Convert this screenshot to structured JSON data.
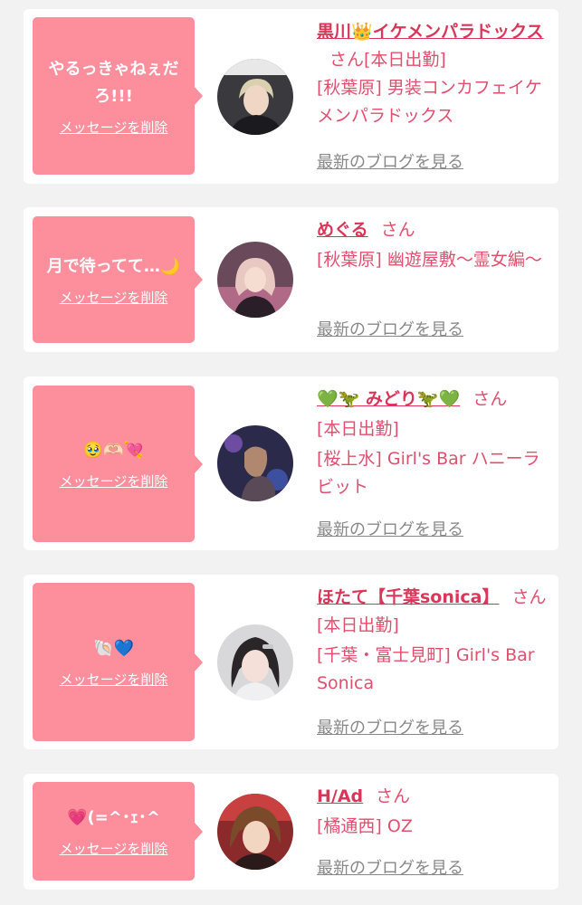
{
  "cards": [
    {
      "message": "やるっきゃねぇだろ!!!",
      "delete_label": "メッセージを削除",
      "name": "黒川👑イケメンパラドックス",
      "san": "さん",
      "status": "[本日出勤]",
      "shop": "[秋葉原] 男装コンカフェイケメンパラドックス",
      "blog_label": "最新のブログを見る",
      "avatar_icon": "profile-photo-icon"
    },
    {
      "message": "月で待ってて…🌙",
      "delete_label": "メッセージを削除",
      "name": "めぐる",
      "san": "さん",
      "status": "",
      "shop": "[秋葉原] 幽遊屋敷～霊女編～",
      "blog_label": "最新のブログを見る",
      "avatar_icon": "profile-photo-icon"
    },
    {
      "message": "🥹🫶🏻💘",
      "delete_label": "メッセージを削除",
      "name": "💚🦖 みどり🦖💚",
      "san": "さん",
      "status": "[本日出勤]",
      "shop": "[桜上水] Girl's Bar ハニーラビット",
      "blog_label": "最新のブログを見る",
      "avatar_icon": "profile-photo-icon"
    },
    {
      "message": "🐚💙",
      "delete_label": "メッセージを削除",
      "name": "ほたて【千葉sonica】",
      "san": "さん",
      "status": "[本日出勤]",
      "shop": "[千葉・富士見町] Girl's Bar Sonica",
      "blog_label": "最新のブログを見る",
      "avatar_icon": "profile-photo-icon"
    },
    {
      "message": "💗(=^･ｪ･^",
      "delete_label": "メッセージを削除",
      "name": "H/Ad",
      "san": "さん",
      "status": "",
      "shop": "[橘通西] OZ",
      "blog_label": "最新のブログを見る",
      "avatar_icon": "profile-photo-icon"
    }
  ],
  "colors": {
    "bubble": "#fd8f9d",
    "name": "#d9365a",
    "text": "#e0506e",
    "blog": "#888888",
    "background": "#f2f2f2"
  }
}
